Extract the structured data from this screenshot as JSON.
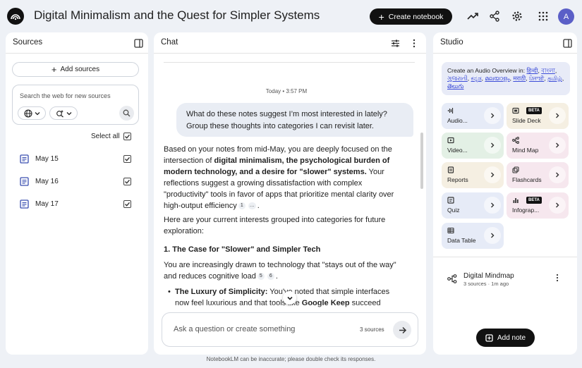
{
  "header": {
    "title": "Digital Minimalism and the Quest for Simpler Systems",
    "create_label": "Create notebook",
    "avatar_letter": "A"
  },
  "sources": {
    "title": "Sources",
    "add_label": "Add sources",
    "search_placeholder": "Search the web for new sources",
    "select_all_label": "Select all",
    "items": [
      {
        "label": "May 15",
        "checked": true
      },
      {
        "label": "May 16",
        "checked": true
      },
      {
        "label": "May 17",
        "checked": true
      }
    ]
  },
  "chat": {
    "title": "Chat",
    "timestamp": "Today • 3:57 PM",
    "user_message": "What do these notes suggest I’m most interested in lately? Group these thoughts into categories I can revisit later.",
    "response": {
      "p1_pre": "Based on your notes from mid-May, you are deeply focused on the intersection of ",
      "p1_bold": "digital minimalism, the psychological burden of modern technology, and a desire for \"slower\" systems.",
      "p1_post": " Your reflections suggest a growing dissatisfaction with complex \"productivity\" tools in favor of apps that prioritize mental clarity over high-output efficiency",
      "p1_cites": [
        "1",
        "…"
      ],
      "p2": "Here are your current interests grouped into categories for future exploration:",
      "h1": "1. The Case for \"Slower\" and Simpler Tech",
      "p3": "You are increasingly drawn to technology that \"stays out of the way\" and reduces cognitive load",
      "p3_cites": [
        "5",
        "6"
      ],
      "b1_bold": "The Luxury of Simplicity:",
      "b1_pre": " You've noted that simple interfaces now feel luxurious and that tools like ",
      "b1_bold2": "Google Keep",
      "b1_post": " succeed because they don't pressure users to be productive or make"
    },
    "input_placeholder": "Ask a question or create something",
    "source_count": "3 sources"
  },
  "studio": {
    "title": "Studio",
    "audio_prefix": "Create an Audio Overview in: ",
    "languages": [
      "हिन्दी",
      "বাংলা",
      "ગુજરાતી",
      "ಕನ್ನಡ",
      "മലയാളം",
      "मराठी",
      "ਪੰਜਾਬੀ",
      "தமிழ்",
      "తెలుగు"
    ],
    "tiles": [
      {
        "label": "Audio...",
        "beta": ""
      },
      {
        "label": "Slide Deck",
        "beta": "BETA"
      },
      {
        "label": "Video...",
        "beta": ""
      },
      {
        "label": "Mind Map",
        "beta": ""
      },
      {
        "label": "Reports",
        "beta": ""
      },
      {
        "label": "Flashcards",
        "beta": ""
      },
      {
        "label": "Quiz",
        "beta": ""
      },
      {
        "label": "Infograp...",
        "beta": "BETA"
      },
      {
        "label": "Data Table",
        "beta": ""
      }
    ],
    "note": {
      "title": "Digital Mindmap",
      "meta": "3 sources · 1m ago"
    },
    "add_note_label": "Add note"
  },
  "footer": "NotebookLM can be inaccurate; please double check its responses.",
  "colors": {
    "accent_dark": "#111111",
    "link_blue": "#3b4bd8",
    "avatar": "#5b5fc7"
  }
}
